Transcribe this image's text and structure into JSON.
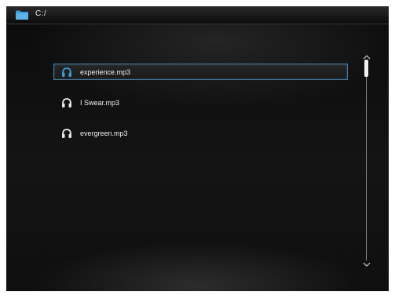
{
  "header": {
    "path": "C:/",
    "folder_icon": "folder-icon",
    "folder_color": "#3d9ad8"
  },
  "files": [
    {
      "name": "experience.mp3",
      "icon": "headphone-icon",
      "selected": true,
      "icon_color": "#3d9ad8"
    },
    {
      "name": "I Swear.mp3",
      "icon": "headphone-icon",
      "selected": false,
      "icon_color": "#e8e8e8"
    },
    {
      "name": "evergreen.mp3",
      "icon": "headphone-icon",
      "selected": false,
      "icon_color": "#e8e8e8"
    }
  ],
  "scrollbar": {
    "position": 0
  },
  "colors": {
    "accent": "#3d9ad8",
    "selection_border": "#4a7da0",
    "background": "#111111"
  }
}
